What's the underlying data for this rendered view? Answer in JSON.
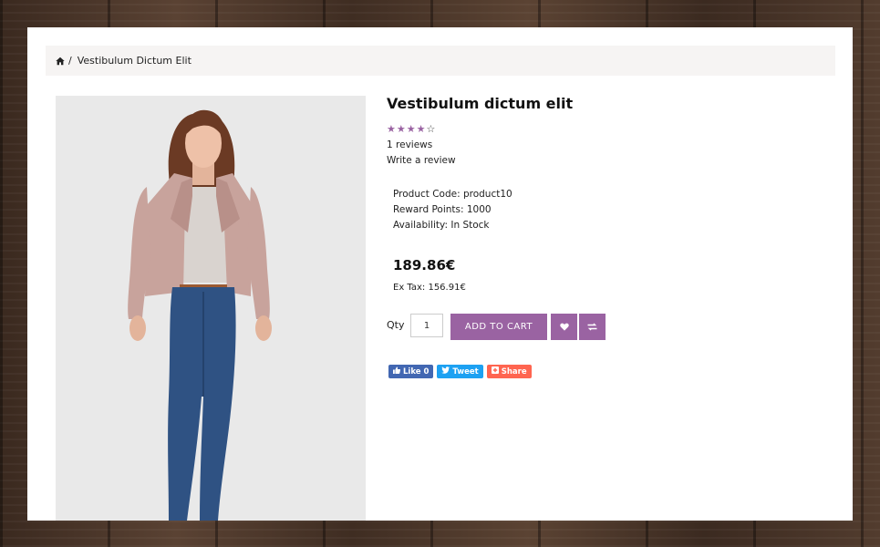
{
  "breadcrumb": {
    "home_icon": "home-icon",
    "separator": "/",
    "current": "Vestibulum Dictum Elit"
  },
  "product": {
    "title": "Vestibulum dictum elit",
    "rating": {
      "value": 4,
      "max": 5,
      "color": "#9a63a2"
    },
    "reviews_link": "1 reviews",
    "write_review_link": "Write a review",
    "details": [
      {
        "label": "Product Code:",
        "value": "product10"
      },
      {
        "label": "Reward Points:",
        "value": "1000"
      },
      {
        "label": "Availability:",
        "value": "In Stock"
      }
    ],
    "price": "189.86€",
    "ex_tax": "Ex Tax: 156.91€"
  },
  "purchase": {
    "qty_label": "Qty",
    "qty_value": "1",
    "add_to_cart": "ADD TO CART",
    "wishlist_icon": "heart-icon",
    "compare_icon": "exchange-icon",
    "accent": "#9a63a2"
  },
  "social": {
    "like": "Like 0",
    "tweet": "Tweet",
    "share": "Share",
    "colors": {
      "like": "#4267b2",
      "tweet": "#1da1f2",
      "share": "#ff6550"
    }
  }
}
